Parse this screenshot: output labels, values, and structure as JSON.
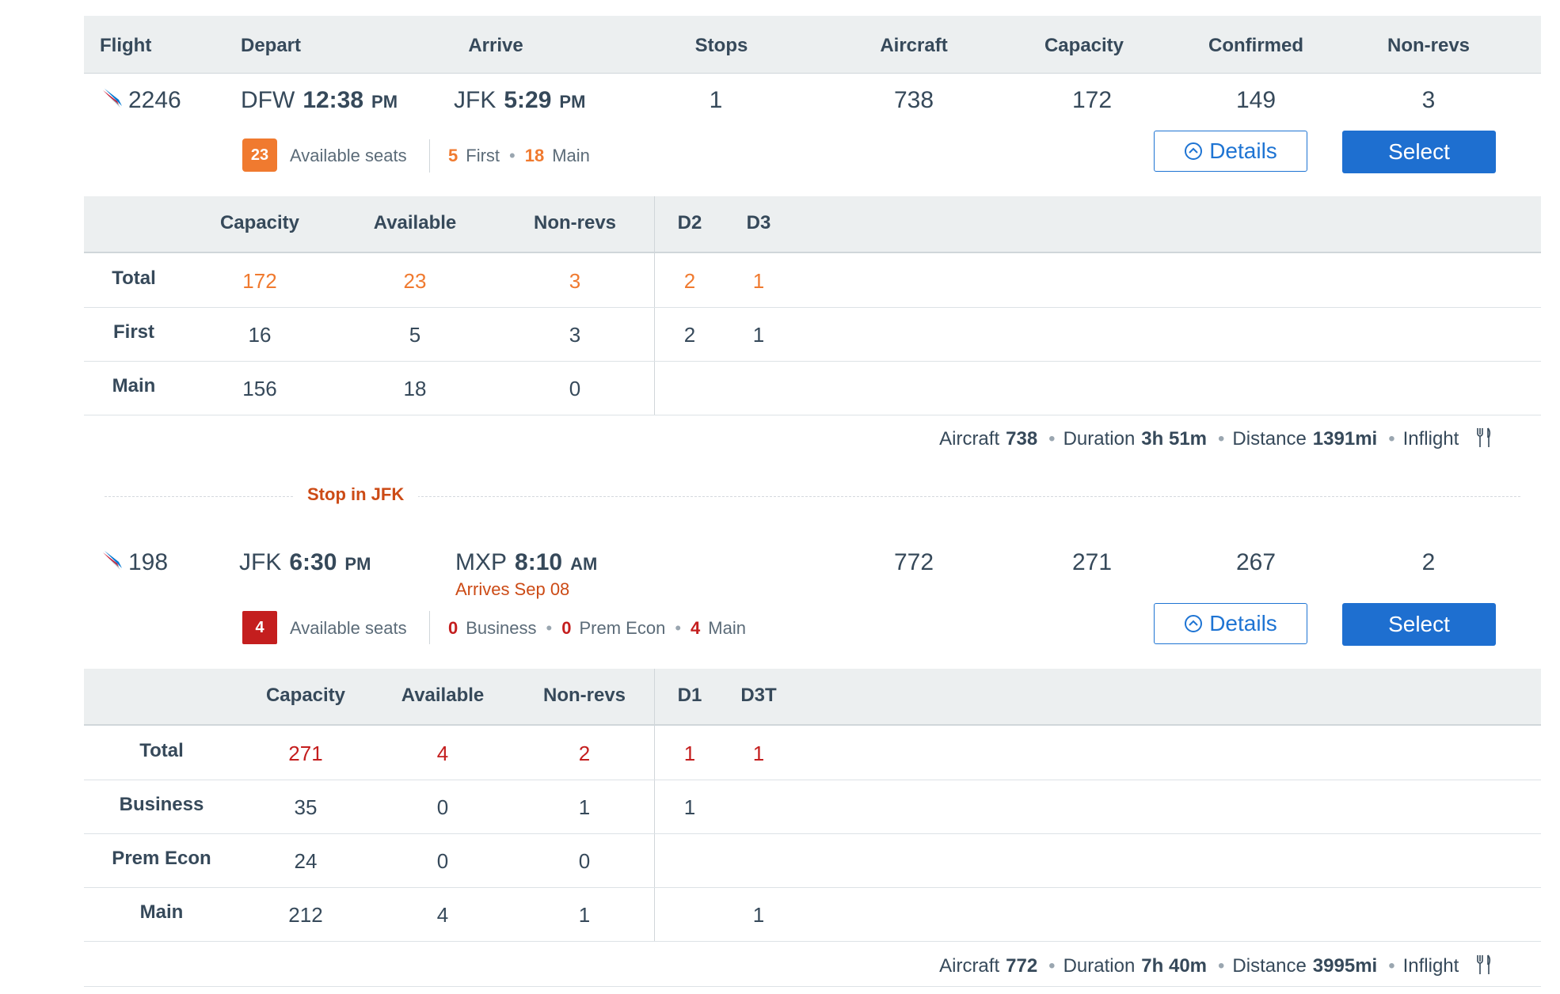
{
  "colors": {
    "accent_blue": "#1e6fd0",
    "orange": "#f07a2f",
    "red": "#c41e1e",
    "stop_orange": "#cc4b16"
  },
  "header": {
    "flight": "Flight",
    "depart": "Depart",
    "arrive": "Arrive",
    "stops": "Stops",
    "aircraft": "Aircraft",
    "capacity": "Capacity",
    "confirmed": "Confirmed",
    "nonrevs": "Non-revs"
  },
  "flights": [
    {
      "number": "2246",
      "depart_airport": "DFW",
      "depart_time": "12:38",
      "depart_ampm": "PM",
      "arrive_airport": "JFK",
      "arrive_time": "5:29",
      "arrive_ampm": "PM",
      "stops": "1",
      "aircraft": "738",
      "capacity": "172",
      "confirmed": "149",
      "nonrevs": "3",
      "available_count": "23",
      "available_label": "Available seats",
      "cabins": [
        {
          "count": "5",
          "name": "First"
        },
        {
          "count": "18",
          "name": "Main"
        }
      ],
      "details_label": "Details",
      "select_label": "Select",
      "table": {
        "headers": [
          "Capacity",
          "Available",
          "Non-revs",
          "D2",
          "D3"
        ],
        "rows": [
          {
            "label": "Total",
            "cells": [
              "172",
              "23",
              "3",
              "2",
              "1"
            ]
          },
          {
            "label": "First",
            "cells": [
              "16",
              "5",
              "3",
              "2",
              "1"
            ]
          },
          {
            "label": "Main",
            "cells": [
              "156",
              "18",
              "0",
              "",
              ""
            ]
          }
        ]
      },
      "info": {
        "aircraft_label": "Aircraft",
        "aircraft": "738",
        "duration_label": "Duration",
        "duration": "3h 51m",
        "distance_label": "Distance",
        "distance": "1391mi",
        "inflight_label": "Inflight"
      }
    },
    {
      "number": "198",
      "depart_airport": "JFK",
      "depart_time": "6:30",
      "depart_ampm": "PM",
      "arrive_airport": "MXP",
      "arrive_time": "8:10",
      "arrive_ampm": "AM",
      "arrives_note": "Arrives Sep 08",
      "aircraft": "772",
      "capacity": "271",
      "confirmed": "267",
      "nonrevs": "2",
      "available_count": "4",
      "available_label": "Available seats",
      "cabins": [
        {
          "count": "0",
          "name": "Business"
        },
        {
          "count": "0",
          "name": "Prem Econ"
        },
        {
          "count": "4",
          "name": "Main"
        }
      ],
      "details_label": "Details",
      "select_label": "Select",
      "table": {
        "headers": [
          "Capacity",
          "Available",
          "Non-revs",
          "D1",
          "D3T"
        ],
        "rows": [
          {
            "label": "Total",
            "cells": [
              "271",
              "4",
              "2",
              "1",
              "1"
            ]
          },
          {
            "label": "Business",
            "cells": [
              "35",
              "0",
              "1",
              "1",
              ""
            ]
          },
          {
            "label": "Prem Econ",
            "cells": [
              "24",
              "0",
              "0",
              "",
              ""
            ]
          },
          {
            "label": "Main",
            "cells": [
              "212",
              "4",
              "1",
              "",
              "1"
            ]
          }
        ]
      },
      "info": {
        "aircraft_label": "Aircraft",
        "aircraft": "772",
        "duration_label": "Duration",
        "duration": "7h 40m",
        "distance_label": "Distance",
        "distance": "3995mi",
        "inflight_label": "Inflight"
      }
    }
  ],
  "stop_label": "Stop in JFK",
  "icons": {
    "airline_logo": "airline-logo-icon",
    "details": "chevron-up-circle-icon",
    "inflight": "fork-knife-icon"
  }
}
